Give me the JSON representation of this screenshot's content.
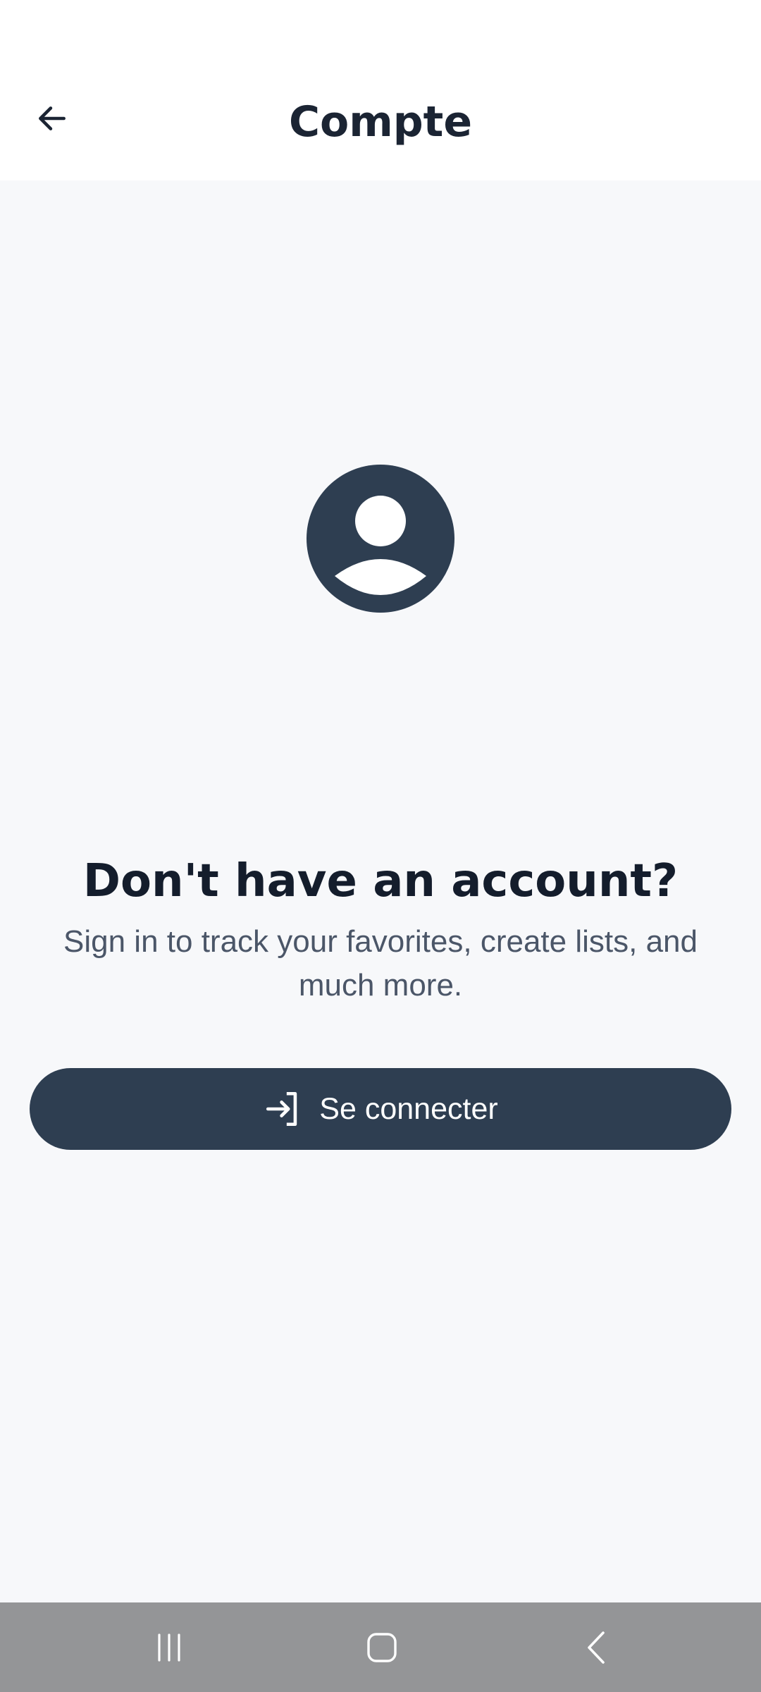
{
  "header": {
    "title": "Compte",
    "back_icon": "arrow-left-icon"
  },
  "empty_state": {
    "icon": "account-circle-icon",
    "headline": "Don't have an account?",
    "subtext": "Sign in to track your favorites, create lists, and much more."
  },
  "signin_button": {
    "label": "Se connecter",
    "icon": "login-icon"
  },
  "system_nav": {
    "recents_icon": "recents-icon",
    "home_icon": "home-icon",
    "back_icon": "back-chevron-icon"
  },
  "colors": {
    "accent": "#2e3e51",
    "background": "#f7f8fa",
    "header_bg": "#ffffff",
    "nav_bar_bg": "#949597"
  }
}
